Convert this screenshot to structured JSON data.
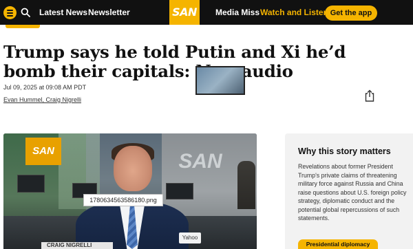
{
  "nav": {
    "links": [
      "Latest News",
      "Newsletter"
    ],
    "logo_text": "SAN",
    "right_links": [
      "Media Miss",
      "Watch and Listen"
    ],
    "cta_label": "Get the app"
  },
  "icons": {
    "menu": "menu-icon",
    "search": "search-icon",
    "share": "share-icon"
  },
  "colors": {
    "accent": "#f5b400",
    "nav_bg": "#111111",
    "card_bg": "#f2f2f2"
  },
  "article": {
    "headline": "Trump says he told Putin and Xi he’d bomb their capitals: New audio",
    "dateline": "Jul 09, 2025 at 09:08 AM PDT",
    "authors": "Evan Hummel, Craig Nigrelli"
  },
  "video": {
    "filename_label": "1780634563586180.png",
    "source_badge": "Yahoo",
    "lower_third": "CRAIG NIGRELLI",
    "studio_sign": "SAN"
  },
  "why_card": {
    "title": "Why this story matters",
    "body": "Revelations about former President Trump's private claims of threatening military force against Russia and China raise questions about U.S. foreign policy strategy, diplomatic conduct and the potential global repercussions of such statements.",
    "tag": "Presidential diplomacy"
  }
}
